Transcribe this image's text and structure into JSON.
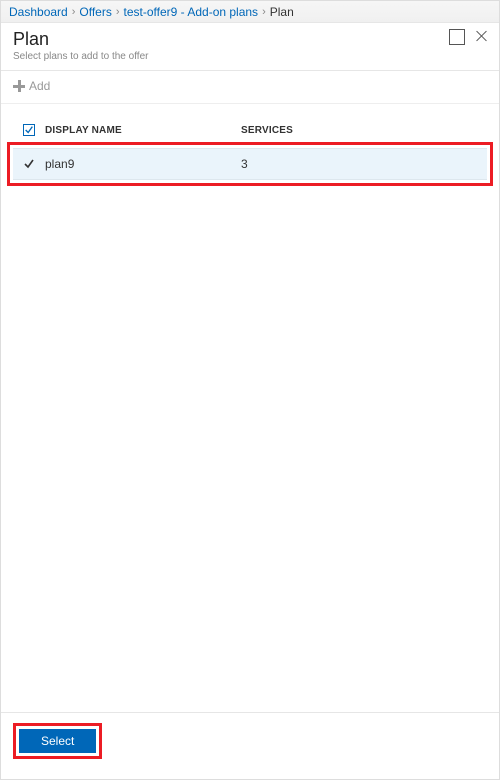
{
  "breadcrumb": {
    "items": [
      {
        "label": "Dashboard",
        "link": true
      },
      {
        "label": "Offers",
        "link": true
      },
      {
        "label": "test-offer9 - Add-on plans",
        "link": true
      },
      {
        "label": "Plan",
        "link": false
      }
    ]
  },
  "header": {
    "title": "Plan",
    "subtitle": "Select plans to add to the offer"
  },
  "toolbar": {
    "add_label": "Add"
  },
  "table": {
    "columns": {
      "display_name": "DISPLAY NAME",
      "services": "SERVICES"
    },
    "rows": [
      {
        "checked": true,
        "display_name": "plan9",
        "services": "3"
      }
    ]
  },
  "footer": {
    "select_label": "Select"
  }
}
